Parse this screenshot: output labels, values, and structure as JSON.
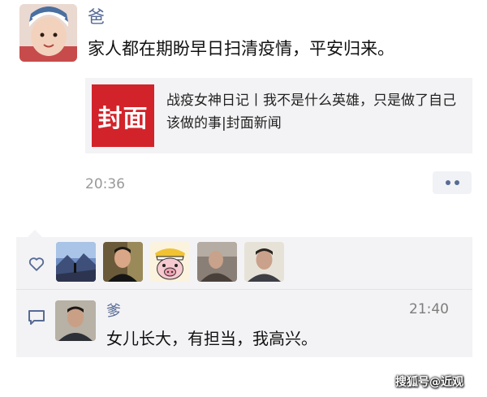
{
  "post": {
    "author": "爸",
    "text": "家人都在期盼早日扫清疫情，平安归来。",
    "time": "20:36"
  },
  "link_card": {
    "thumb_text": "封面",
    "title": "战疫女神日记丨我不是什么英雄，只是做了自己该做的事|封面新闻"
  },
  "interactions": {
    "likes": [
      {
        "avatar": "landscape-avatar"
      },
      {
        "avatar": "man-portrait-avatar"
      },
      {
        "avatar": "cartoon-pig-avatar"
      },
      {
        "avatar": "man-photo-avatar"
      },
      {
        "avatar": "man-selfie-avatar"
      }
    ],
    "comment": {
      "author": "爹",
      "time": "21:40",
      "text": "女儿长大，有担当，我高兴。"
    }
  },
  "watermark": "搜狐号@近观",
  "colors": {
    "name_blue": "#576b95",
    "panel_bg": "#f3f3f5",
    "brand_red": "#d2232a",
    "time_gray": "#999999"
  }
}
